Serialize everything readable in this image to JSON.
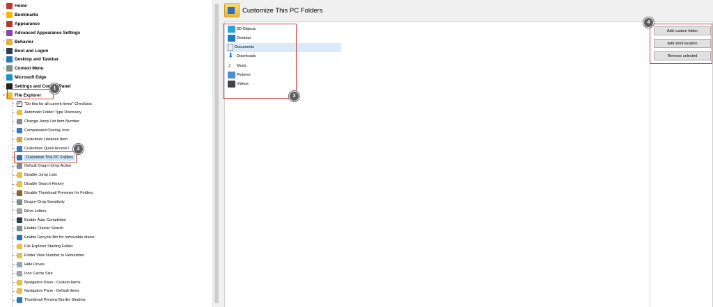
{
  "tree": {
    "top_items": [
      {
        "label": "Home",
        "icon": "home-icon",
        "color": "#c0392b"
      },
      {
        "label": "Bookmarks",
        "icon": "star-icon",
        "color": "#f5b800"
      },
      {
        "label": "Appearance",
        "icon": "palette-icon",
        "color": "#b03a2e"
      },
      {
        "label": "Advanced Appearance Settings",
        "icon": "palette-advanced-icon",
        "color": "#8e44ad"
      },
      {
        "label": "Behavior",
        "icon": "behavior-icon",
        "color": "#e0b040"
      },
      {
        "label": "Boot and Logon",
        "icon": "boot-icon",
        "color": "#2c3e50"
      },
      {
        "label": "Desktop and Taskbar",
        "icon": "desktop-icon",
        "color": "#2a7ab8"
      },
      {
        "label": "Context Menu",
        "icon": "context-menu-icon",
        "color": "#7f8c8d"
      },
      {
        "label": "Microsoft Edge",
        "icon": "edge-icon",
        "color": "#1e8fc9"
      },
      {
        "label": "Settings and Control Panel",
        "icon": "settings-icon",
        "color": "#222222"
      },
      {
        "label": "File Explorer",
        "icon": "folder-icon",
        "color": "#e8c14a"
      }
    ],
    "sub_items": [
      {
        "label": "\"Do this for all current items\" Checkbox",
        "icon": "checkbox-icon"
      },
      {
        "label": "Automatic Folder Type Discovery",
        "icon": "folder-icon"
      },
      {
        "label": "Change Jump List Item Number",
        "icon": "list-icon"
      },
      {
        "label": "Compressed Overlay Icon",
        "icon": "arrows-icon"
      },
      {
        "label": "Customize Libraries Item",
        "icon": "library-icon"
      },
      {
        "label": "Customize Quick Access I",
        "icon": "star-icon"
      },
      {
        "label": "Customize This PC Folders",
        "icon": "pc-icon"
      },
      {
        "label": "Default Drag-n-Drop Action",
        "icon": "drag-icon"
      },
      {
        "label": "Disable Jump Lists",
        "icon": "list-icon"
      },
      {
        "label": "Disable Search History",
        "icon": "folder-icon"
      },
      {
        "label": "Disable Thumbnail Previews for Folders",
        "icon": "folder-icon"
      },
      {
        "label": "Drag-n-Drop Sensitivity",
        "icon": "drag-icon"
      },
      {
        "label": "Drive Letters",
        "icon": "drive-icon"
      },
      {
        "label": "Enable Auto Completion",
        "icon": "cursor-icon"
      },
      {
        "label": "Enable Classic Search",
        "icon": "search-icon"
      },
      {
        "label": "Enable Recycle Bin for removable drives",
        "icon": "recycle-icon"
      },
      {
        "label": "File Explorer Starting Folder",
        "icon": "folder-icon"
      },
      {
        "label": "Folder View Number to Remember",
        "icon": "folder-icon"
      },
      {
        "label": "Hide Drives",
        "icon": "drive-icon"
      },
      {
        "label": "Icon Cache Size",
        "icon": "drive-icon"
      },
      {
        "label": "Navigation Pane - Custom Items",
        "icon": "folder-icon"
      },
      {
        "label": "Navigation Pane - Default Items",
        "icon": "folder-icon"
      },
      {
        "label": "Thumbnail Preview Border Shadow",
        "icon": "thumbnail-icon"
      }
    ]
  },
  "header": {
    "title": "Customize This PC Folders",
    "icon": "pc-folder-icon"
  },
  "folders": [
    {
      "label": "3D Objects",
      "icon": "3d-objects-icon",
      "color": "#2aa6d6"
    },
    {
      "label": "Desktop",
      "icon": "desktop-icon",
      "color": "#1f7dc8"
    },
    {
      "label": "Documents",
      "icon": "documents-icon",
      "color": "#9aa4ae"
    },
    {
      "label": "Downloads",
      "icon": "downloads-icon",
      "color": "#1f7dc8"
    },
    {
      "label": "Music",
      "icon": "music-icon",
      "color": "#1f5fa8"
    },
    {
      "label": "Pictures",
      "icon": "pictures-icon",
      "color": "#4a8fcf"
    },
    {
      "label": "Videos",
      "icon": "videos-icon",
      "color": "#444444"
    }
  ],
  "buttons": {
    "add_custom": "Add custom folder",
    "add_shell": "Add shell location",
    "remove_selected": "Remove selected"
  },
  "markers": [
    "1",
    "2",
    "3",
    "4"
  ],
  "colors": {
    "annotation_red": "#d23a3a",
    "selection_blue": "#cde8ff",
    "highlight_row": "#d9ebfa"
  }
}
